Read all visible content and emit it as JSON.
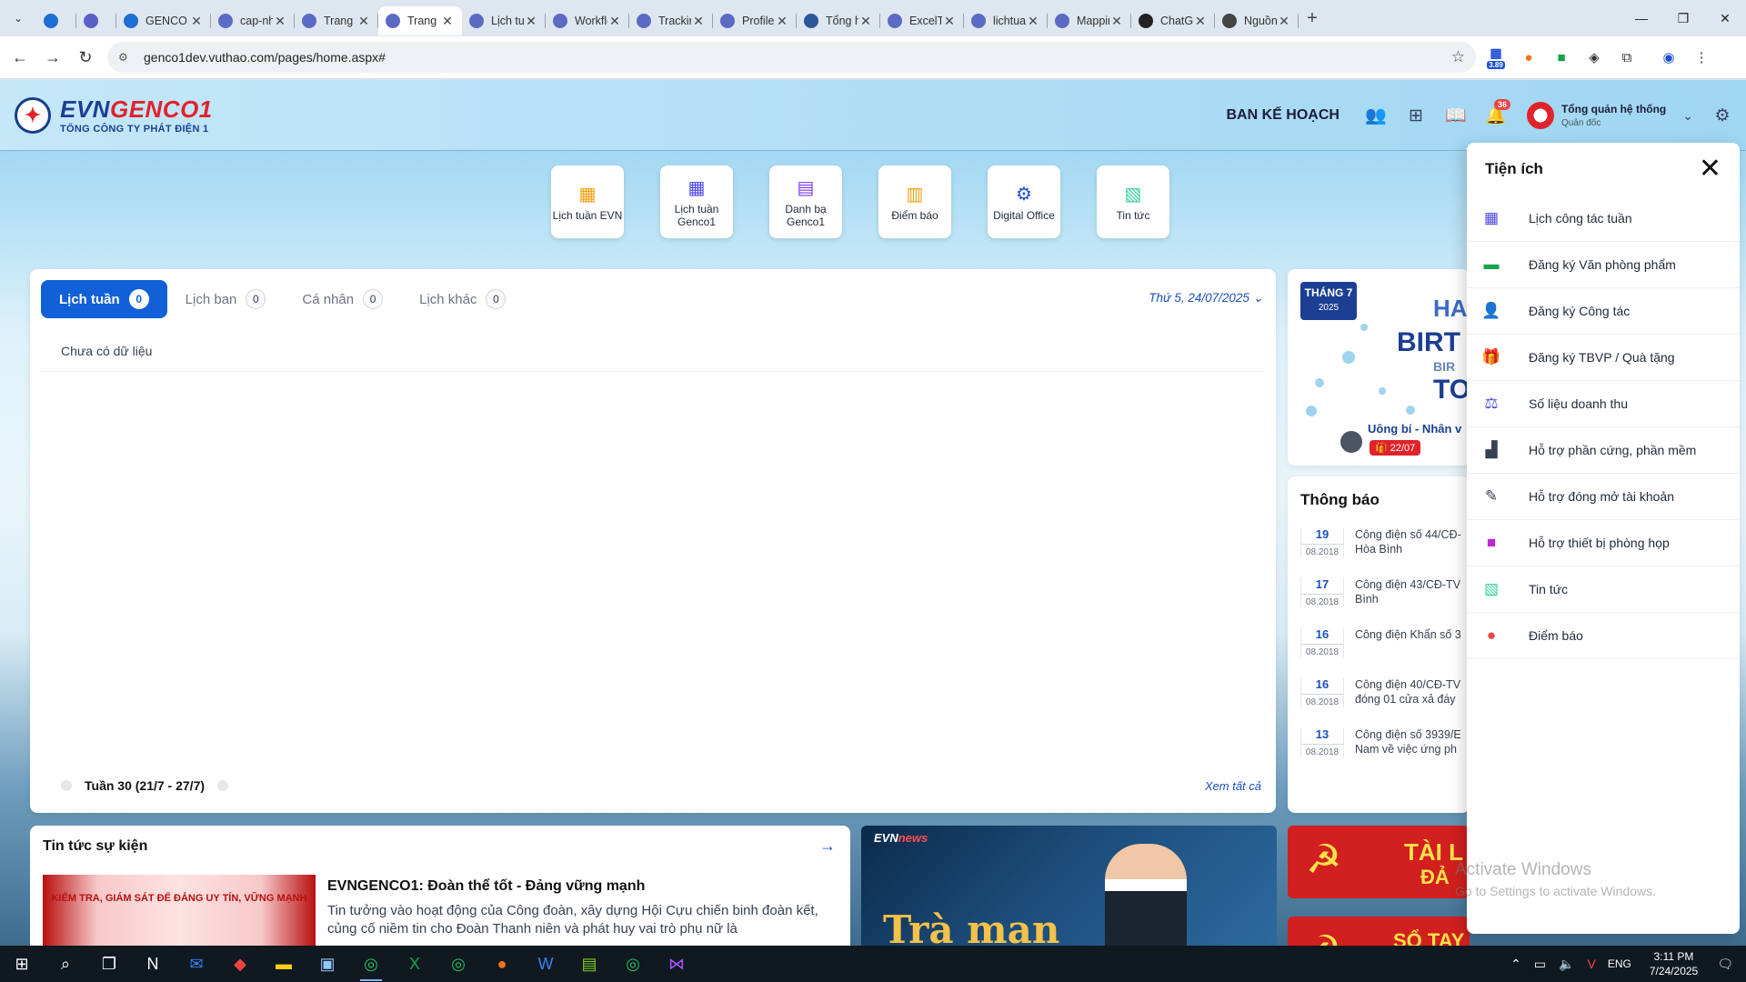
{
  "browser": {
    "tabs": [
      {
        "label": "",
        "icon": "ado-icon",
        "color": "#1d6fd1"
      },
      {
        "label": "",
        "icon": "teams-icon",
        "color": "#5b5fc7"
      },
      {
        "label": "GENCO",
        "icon": "ado-icon",
        "color": "#1d6fd1"
      },
      {
        "label": "cap-nh",
        "icon": "evn-icon",
        "color": "#5b6bc4"
      },
      {
        "label": "Trang c",
        "icon": "evn-icon",
        "color": "#5b6bc4"
      },
      {
        "label": "Trang c",
        "icon": "evn-icon",
        "color": "#5b6bc4",
        "active": true
      },
      {
        "label": "Lịch tu",
        "icon": "evn-icon",
        "color": "#5b6bc4"
      },
      {
        "label": "Workflo",
        "icon": "evn-icon",
        "color": "#5b6bc4"
      },
      {
        "label": "Tracking",
        "icon": "evn-icon",
        "color": "#5b6bc4"
      },
      {
        "label": "Profile",
        "icon": "evn-icon",
        "color": "#5b6bc4"
      },
      {
        "label": "Tổng h",
        "icon": "word-icon",
        "color": "#2b579a"
      },
      {
        "label": "ExcelTe",
        "icon": "evn-icon",
        "color": "#5b6bc4"
      },
      {
        "label": "lichtuan",
        "icon": "evn-icon",
        "color": "#5b6bc4"
      },
      {
        "label": "Mappin",
        "icon": "evn-icon",
        "color": "#5b6bc4"
      },
      {
        "label": "ChatGP",
        "icon": "chatgpt-icon",
        "color": "#222222"
      },
      {
        "label": "Nguồn",
        "icon": "globe-icon",
        "color": "#444444"
      }
    ],
    "url": "genco1dev.vuthao.com/pages/home.aspx#",
    "extension_badge": "3.89"
  },
  "header": {
    "logo_main": "EVN",
    "logo_accent": "GENCO1",
    "logo_sub": "TỔNG CÔNG TY PHÁT ĐIỆN 1",
    "department": "BAN KẾ HOẠCH",
    "notification_count": "36",
    "user_name": "Tổng quản hệ thống",
    "user_role": "Quản đốc"
  },
  "tiles": [
    {
      "label": "Lịch tuần EVN",
      "icon": "calendar-icon",
      "color": "#f59e0b"
    },
    {
      "label": "Lịch tuần Genco1",
      "icon": "calendar-icon",
      "color": "#4f46e5"
    },
    {
      "label": "Danh bạ Genco1",
      "icon": "contacts-icon",
      "color": "#7c3aed"
    },
    {
      "label": "Điểm báo",
      "icon": "clipboard-icon",
      "color": "#f59e0b"
    },
    {
      "label": "Digital Office",
      "icon": "gears-icon",
      "color": "#1d4ed8"
    },
    {
      "label": "Tin tức",
      "icon": "news-icon",
      "color": "#34d399"
    }
  ],
  "schedule": {
    "tabs": [
      {
        "label": "Lịch tuần",
        "count": "0",
        "active": true
      },
      {
        "label": "Lịch ban",
        "count": "0"
      },
      {
        "label": "Cá nhân",
        "count": "0"
      },
      {
        "label": "Lịch khác",
        "count": "0"
      }
    ],
    "date": "Thứ 5, 24/07/2025",
    "empty_text": "Chưa có dữ liệu",
    "week_label": "Tuần 30 (21/7 - 27/7)",
    "see_all": "Xem tất cả"
  },
  "birthday": {
    "month": "THÁNG 7",
    "year": "2025",
    "banner_text": [
      "HA",
      "BIRT",
      "BIR",
      "TO"
    ],
    "person": "Uông bí - Nhân v",
    "date": "22/07"
  },
  "notices": {
    "title": "Thông báo",
    "items": [
      {
        "day": "19",
        "month": "08.2018",
        "text": "Công điện số 44/CĐ-",
        "text2": "Hòa Bình"
      },
      {
        "day": "17",
        "month": "08.2018",
        "text": "Công điện 43/CĐ-TV",
        "text2": "Bình"
      },
      {
        "day": "16",
        "month": "08.2018",
        "text": "Công điện Khẩn số 3",
        "text2": ""
      },
      {
        "day": "16",
        "month": "08.2018",
        "text": "Công điện 40/CĐ-TV",
        "text2": "đóng 01 cửa xả đáy"
      },
      {
        "day": "13",
        "month": "08.2018",
        "text": "Công điện số 3939/E",
        "text2": "Nam về việc ứng ph"
      }
    ]
  },
  "news": {
    "title": "Tin tức sự kiện",
    "image_caption": "KIỂM TRA, GIÁM SÁT ĐỂ ĐẢNG UY TÍN, VỮNG MẠNH",
    "headline": "EVNGENCO1: Đoàn thể tốt - Đảng vững mạnh",
    "body": "Tin tưởng vào hoạt động của Công đoàn, xây dựng Hội Cựu chiến binh đoàn kết, củng cố niềm tin cho Đoàn Thanh niên và phát huy vai trò phụ nữ là"
  },
  "video": {
    "brand_a": "EVN",
    "brand_b": "news",
    "caption": "Trà man"
  },
  "party": {
    "box1": "TÀI L",
    "box1b": "ĐẢ",
    "box2": "SỔ TAY ĐẢNG VIÊN"
  },
  "utilities": {
    "title": "Tiện ích",
    "items": [
      {
        "label": "Lịch công tác tuần",
        "icon": "calendar-icon",
        "color": "#4f46e5"
      },
      {
        "label": "Đăng ký Văn phòng phẩm",
        "icon": "archive-icon",
        "color": "#16a34a"
      },
      {
        "label": "Đăng ký Công tác",
        "icon": "person-icon",
        "color": "#111827"
      },
      {
        "label": "Đăng ký TBVP / Quà tặng",
        "icon": "gift-icon",
        "color": "#f97316"
      },
      {
        "label": "Số liệu doanh thu",
        "icon": "revenue-icon",
        "color": "#4f46e5"
      },
      {
        "label": "Hỗ trợ phần cứng, phần mềm",
        "icon": "bar-chart-icon",
        "color": "#374151"
      },
      {
        "label": "Hỗ trợ đóng mở tài khoản",
        "icon": "user-edit-icon",
        "color": "#374151"
      },
      {
        "label": "Hỗ trợ thiết bị phòng họp",
        "icon": "video-icon",
        "color": "#c026d3"
      },
      {
        "label": "Tin tức",
        "icon": "news-icon",
        "color": "#34d399"
      },
      {
        "label": "Điểm báo",
        "icon": "newspaper-icon",
        "color": "#ef4444"
      }
    ]
  },
  "watermark": {
    "line1": "Activate Windows",
    "line2": "Go to Settings to activate Windows."
  },
  "taskbar": {
    "lang": "ENG",
    "time": "3:11 PM",
    "date": "7/24/2025"
  }
}
